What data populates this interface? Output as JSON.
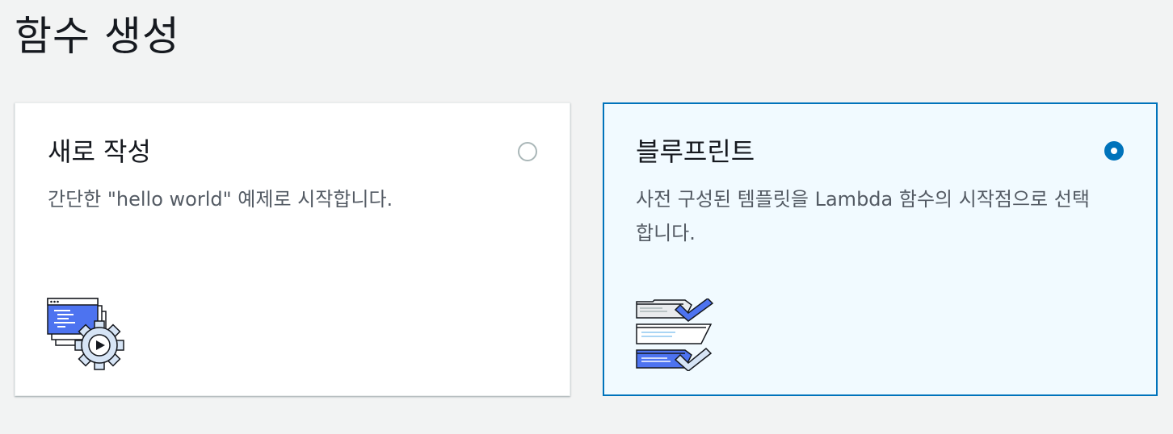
{
  "page": {
    "title": "함수 생성"
  },
  "options": [
    {
      "title": "새로 작성",
      "description": "간단한 \"hello world\" 예제로 시작합니다.",
      "selected": false,
      "icon": "code-window-gear-icon"
    },
    {
      "title": "블루프린트",
      "description": "사전 구성된 템플릿을 Lambda 함수의 시작점으로 선택합니다.",
      "selected": true,
      "icon": "blueprint-checklist-icon"
    }
  ],
  "colors": {
    "background": "#f2f3f3",
    "selected_border": "#0073bb",
    "selected_background": "#f1faff",
    "icon_accent": "#3f6ef5"
  }
}
